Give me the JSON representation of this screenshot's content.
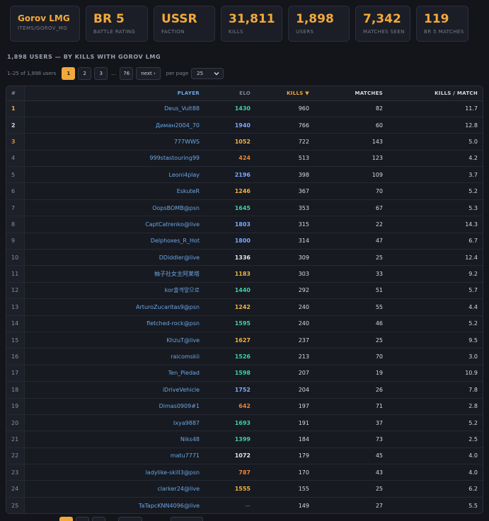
{
  "stats": [
    {
      "value": "Gorov LMG",
      "label": "ITEMS/GOROV_MG"
    },
    {
      "value": "BR 5",
      "label": "BATTLE RATING"
    },
    {
      "value": "USSR",
      "label": "FACTION"
    },
    {
      "value": "31,811",
      "label": "KILLS"
    },
    {
      "value": "1,898",
      "label": "USERS"
    },
    {
      "value": "7,342",
      "label": "MATCHES SEEN"
    },
    {
      "value": "119",
      "label": "BR 5 MATCHES"
    }
  ],
  "section_title": "1,898 USERS — BY KILLS WITH GOROV LMG",
  "pager": {
    "range": "1–25 of 1,898 users",
    "pages": [
      "1",
      "2",
      "3"
    ],
    "dots": "…",
    "last": "76",
    "next": "next ›",
    "per_page_label": "per page",
    "per_page_value": "25"
  },
  "columns": {
    "rank": "#",
    "player": "PLAYER",
    "elo": "ELO",
    "kills": "KILLS ▼",
    "matches": "MATCHES",
    "kpm": "KILLS / MATCH"
  },
  "colors": {
    "accent": "#f2a93b",
    "background": "#13151b",
    "player_link": "#6ba6e6"
  },
  "rows": [
    {
      "rank": "1",
      "player": "Deus_Vult88",
      "elo": "1430",
      "elo_tier": "green",
      "kills": "960",
      "matches": "82",
      "kpm": "11.7"
    },
    {
      "rank": "2",
      "player": "Диман2004_70",
      "elo": "1940",
      "elo_tier": "blue",
      "kills": "766",
      "matches": "60",
      "kpm": "12.8"
    },
    {
      "rank": "3",
      "player": "777WWS",
      "elo": "1052",
      "elo_tier": "yellow",
      "kills": "722",
      "matches": "143",
      "kpm": "5.0"
    },
    {
      "rank": "4",
      "player": "999stastouring99",
      "elo": "424",
      "elo_tier": "orange",
      "kills": "513",
      "matches": "123",
      "kpm": "4.2"
    },
    {
      "rank": "5",
      "player": "Leoni4play",
      "elo": "2196",
      "elo_tier": "blue",
      "kills": "398",
      "matches": "109",
      "kpm": "3.7"
    },
    {
      "rank": "6",
      "player": "EskuteR",
      "elo": "1246",
      "elo_tier": "yellow",
      "kills": "367",
      "matches": "70",
      "kpm": "5.2"
    },
    {
      "rank": "7",
      "player": "OopsBOMB@psn",
      "elo": "1645",
      "elo_tier": "green",
      "kills": "353",
      "matches": "67",
      "kpm": "5.3"
    },
    {
      "rank": "8",
      "player": "CaptCatrenko@live",
      "elo": "1803",
      "elo_tier": "blue",
      "kills": "315",
      "matches": "22",
      "kpm": "14.3"
    },
    {
      "rank": "9",
      "player": "Delphoxes_R_Hot",
      "elo": "1800",
      "elo_tier": "blue",
      "kills": "314",
      "matches": "47",
      "kpm": "6.7"
    },
    {
      "rank": "10",
      "player": "DDiddler@live",
      "elo": "1336",
      "elo_tier": "white",
      "kills": "309",
      "matches": "25",
      "kpm": "12.4"
    },
    {
      "rank": "11",
      "player": "柚子社女主阿莱塔",
      "elo": "1183",
      "elo_tier": "yellow",
      "kills": "303",
      "matches": "33",
      "kpm": "9.2"
    },
    {
      "rank": "12",
      "player": "kor출격앞으로",
      "elo": "1440",
      "elo_tier": "green",
      "kills": "292",
      "matches": "51",
      "kpm": "5.7"
    },
    {
      "rank": "13",
      "player": "ArturoZucaritas9@psn",
      "elo": "1242",
      "elo_tier": "yellow",
      "kills": "240",
      "matches": "55",
      "kpm": "4.4"
    },
    {
      "rank": "14",
      "player": "fletched-rock@psn",
      "elo": "1595",
      "elo_tier": "green",
      "kills": "240",
      "matches": "46",
      "kpm": "5.2"
    },
    {
      "rank": "15",
      "player": "KhzuT@live",
      "elo": "1627",
      "elo_tier": "yellow",
      "kills": "237",
      "matches": "25",
      "kpm": "9.5"
    },
    {
      "rank": "16",
      "player": "raicomskii",
      "elo": "1526",
      "elo_tier": "green",
      "kills": "213",
      "matches": "70",
      "kpm": "3.0"
    },
    {
      "rank": "17",
      "player": "Ten_Piedad",
      "elo": "1598",
      "elo_tier": "green",
      "kills": "207",
      "matches": "19",
      "kpm": "10.9"
    },
    {
      "rank": "18",
      "player": "iDriveVehicle",
      "elo": "1752",
      "elo_tier": "blue",
      "kills": "204",
      "matches": "26",
      "kpm": "7.8"
    },
    {
      "rank": "19",
      "player": "Dimas0909#1",
      "elo": "642",
      "elo_tier": "orange",
      "kills": "197",
      "matches": "71",
      "kpm": "2.8"
    },
    {
      "rank": "20",
      "player": "Ixya9887",
      "elo": "1693",
      "elo_tier": "green",
      "kills": "191",
      "matches": "37",
      "kpm": "5.2"
    },
    {
      "rank": "21",
      "player": "Niks48",
      "elo": "1399",
      "elo_tier": "green",
      "kills": "184",
      "matches": "73",
      "kpm": "2.5"
    },
    {
      "rank": "22",
      "player": "matu7771",
      "elo": "1072",
      "elo_tier": "white",
      "kills": "179",
      "matches": "45",
      "kpm": "4.0"
    },
    {
      "rank": "23",
      "player": "ladylike-skill3@psn",
      "elo": "787",
      "elo_tier": "orange",
      "kills": "170",
      "matches": "43",
      "kpm": "4.0"
    },
    {
      "rank": "24",
      "player": "clarker24@live",
      "elo": "1555",
      "elo_tier": "yellow",
      "kills": "155",
      "matches": "25",
      "kpm": "6.2"
    },
    {
      "rank": "25",
      "player": "TaTapcKNN4096@live",
      "elo": "—",
      "elo_tier": "gray",
      "kills": "149",
      "matches": "27",
      "kpm": "5.5"
    }
  ]
}
